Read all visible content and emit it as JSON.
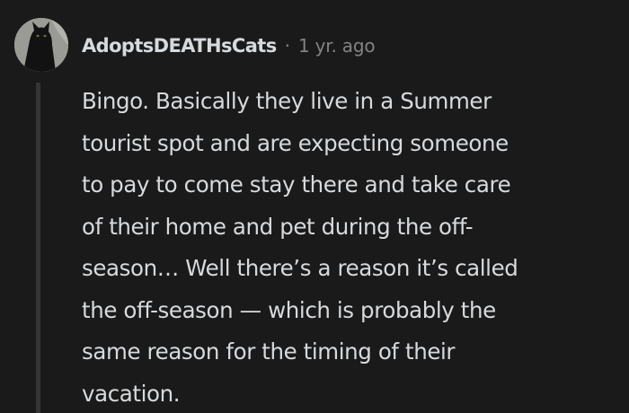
{
  "comment": {
    "username": "AdoptsDEATHsCats",
    "separator": "·",
    "timestamp": "1 yr. ago",
    "body_lines": [
      "Bingo. Basically they live in a Summer",
      "tourist spot and are expecting someone",
      "to pay to come stay there and take care",
      "of their home and pet during the off-",
      "season… Well there’s a reason it’s called",
      "the off-season — which is probably the",
      "same reason for the timing of their",
      "vacation."
    ]
  },
  "colors": {
    "background": "#1a1a1b",
    "text": "#d7dadc",
    "meta": "#818384",
    "thread_line": "#343536"
  },
  "icons": {
    "avatar": "user-avatar-black-cat"
  }
}
